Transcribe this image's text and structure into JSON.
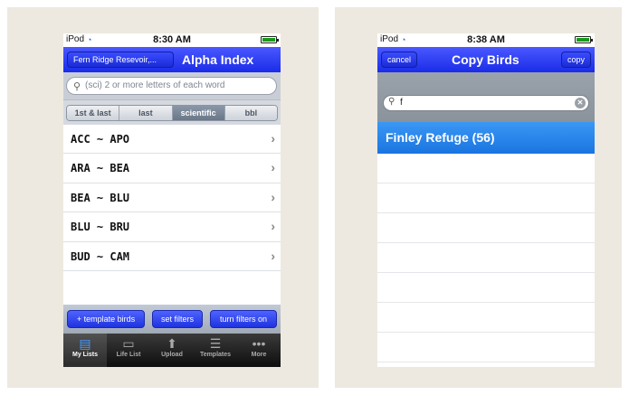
{
  "left": {
    "status": {
      "carrier": "iPod",
      "time": "8:30 AM"
    },
    "nav": {
      "back_label": "Fern Ridge Resevoir,...",
      "title": "Alpha Index"
    },
    "search": {
      "placeholder": "(sci) 2 or more letters of each word"
    },
    "segments": [
      "1st & last",
      "last",
      "scientific",
      "bbl"
    ],
    "active_segment": "scientific",
    "rows": [
      "ACC ~ APO",
      "ARA ~ BEA",
      "BEA ~ BLU",
      "BLU ~ BRU",
      "BUD ~ CAM"
    ],
    "actions": {
      "template_birds": "+ template birds",
      "set_filters": "set filters",
      "turn_filters_on": "turn filters on"
    },
    "tabs": [
      {
        "label": "My Lists",
        "icon": "document-icon"
      },
      {
        "label": "Life List",
        "icon": "page-icon"
      },
      {
        "label": "Upload",
        "icon": "upload-arrow-icon"
      },
      {
        "label": "Templates",
        "icon": "list-icon"
      },
      {
        "label": "More",
        "icon": "more-dots-icon"
      }
    ],
    "active_tab": "My Lists"
  },
  "right": {
    "status": {
      "carrier": "iPod",
      "time": "8:38 AM"
    },
    "nav": {
      "cancel_label": "cancel",
      "title": "Copy Birds",
      "copy_label": "copy"
    },
    "search": {
      "value": "f"
    },
    "highlight": "Finley Refuge (56)"
  },
  "colors": {
    "nav_blue": "#1a2ce8",
    "highlight_blue": "#1a74e0"
  }
}
